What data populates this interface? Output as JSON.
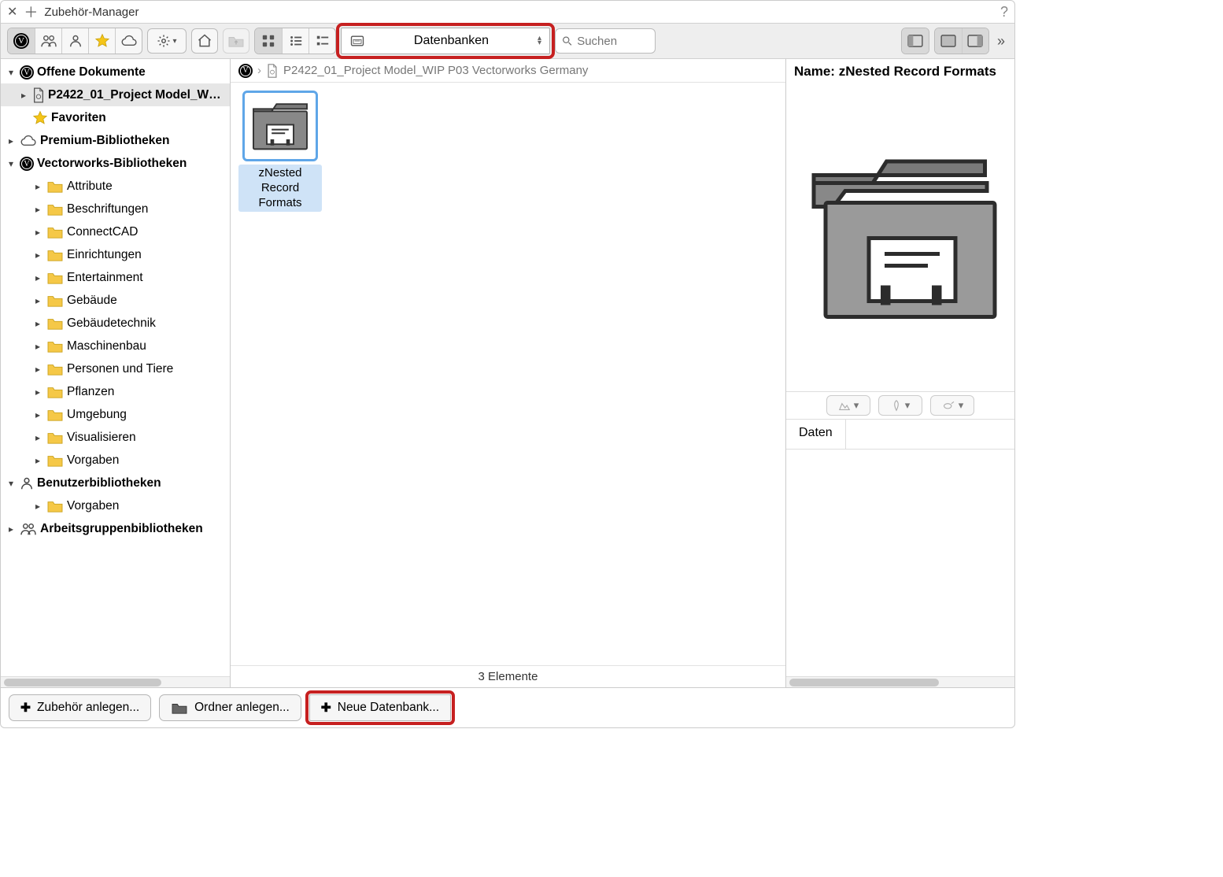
{
  "window": {
    "title": "Zubehör-Manager"
  },
  "toolbar": {
    "filter_label": "Datenbanken",
    "search_placeholder": "Suchen"
  },
  "sidebar": {
    "sections": [
      {
        "label": "Offene Dokumente",
        "icon": "vw",
        "expanded": true,
        "bold": true,
        "indent": 0
      },
      {
        "label": "P2422_01_Project Model_W…",
        "icon": "doc",
        "expanded": false,
        "bold": true,
        "indent": 1,
        "selected": true
      },
      {
        "label": "Favoriten",
        "icon": "star",
        "expanded": null,
        "bold": true,
        "indent": 1
      },
      {
        "label": "Premium-Bibliotheken",
        "icon": "cloud",
        "expanded": false,
        "bold": true,
        "indent": 0
      },
      {
        "label": "Vectorworks-Bibliotheken",
        "icon": "vw",
        "expanded": true,
        "bold": true,
        "indent": 0
      },
      {
        "label": "Attribute",
        "icon": "folder",
        "expanded": false,
        "bold": false,
        "indent": 2
      },
      {
        "label": "Beschriftungen",
        "icon": "folder",
        "expanded": false,
        "bold": false,
        "indent": 2
      },
      {
        "label": "ConnectCAD",
        "icon": "folder",
        "expanded": false,
        "bold": false,
        "indent": 2
      },
      {
        "label": "Einrichtungen",
        "icon": "folder",
        "expanded": false,
        "bold": false,
        "indent": 2
      },
      {
        "label": "Entertainment",
        "icon": "folder",
        "expanded": false,
        "bold": false,
        "indent": 2
      },
      {
        "label": "Gebäude",
        "icon": "folder",
        "expanded": false,
        "bold": false,
        "indent": 2
      },
      {
        "label": "Gebäudetechnik",
        "icon": "folder",
        "expanded": false,
        "bold": false,
        "indent": 2
      },
      {
        "label": "Maschinenbau",
        "icon": "folder",
        "expanded": false,
        "bold": false,
        "indent": 2
      },
      {
        "label": "Personen und Tiere",
        "icon": "folder",
        "expanded": false,
        "bold": false,
        "indent": 2
      },
      {
        "label": "Pflanzen",
        "icon": "folder",
        "expanded": false,
        "bold": false,
        "indent": 2
      },
      {
        "label": "Umgebung",
        "icon": "folder",
        "expanded": false,
        "bold": false,
        "indent": 2
      },
      {
        "label": "Visualisieren",
        "icon": "folder",
        "expanded": false,
        "bold": false,
        "indent": 2
      },
      {
        "label": "Vorgaben",
        "icon": "folder",
        "expanded": false,
        "bold": false,
        "indent": 2
      },
      {
        "label": "Benutzerbibliotheken",
        "icon": "user",
        "expanded": true,
        "bold": true,
        "indent": 0
      },
      {
        "label": "Vorgaben",
        "icon": "folder",
        "expanded": false,
        "bold": false,
        "indent": 2
      },
      {
        "label": "Arbeitsgruppenbibliotheken",
        "icon": "group",
        "expanded": false,
        "bold": true,
        "indent": 0
      }
    ]
  },
  "breadcrumb": {
    "doc": "P2422_01_Project Model_WIP P03 Vectorworks Germany"
  },
  "content": {
    "items": [
      {
        "name": "zNested Record Formats"
      }
    ],
    "status": "3 Elemente"
  },
  "preview": {
    "name_label": "Name:",
    "name_value": "zNested Record Formats",
    "tab_data": "Daten"
  },
  "bottom": {
    "create_resource": "Zubehör anlegen...",
    "create_folder": "Ordner anlegen...",
    "create_db": "Neue Datenbank..."
  }
}
